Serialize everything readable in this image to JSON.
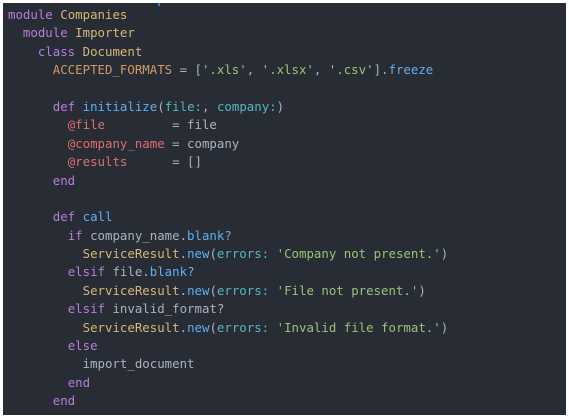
{
  "editor": {
    "language": "ruby",
    "theme_colors": {
      "background": "#282c34",
      "keyword": "#b57edc",
      "class": "#d8b776",
      "constant": "#d19a66",
      "string": "#98c379",
      "instance_variable": "#e06c75",
      "method": "#61afef",
      "symbol": "#56b6c2",
      "plain": "#abb2bf"
    },
    "lines": [
      [
        [
          "module",
          "kw"
        ],
        [
          " ",
          "plain"
        ],
        [
          "Companies",
          "cls"
        ]
      ],
      [
        [
          "  ",
          "plain"
        ],
        [
          "module",
          "kw"
        ],
        [
          " ",
          "plain"
        ],
        [
          "Importer",
          "cls"
        ]
      ],
      [
        [
          "    ",
          "plain"
        ],
        [
          "class",
          "kw"
        ],
        [
          " ",
          "plain"
        ],
        [
          "Document",
          "cls"
        ]
      ],
      [
        [
          "      ",
          "plain"
        ],
        [
          "ACCEPTED_FORMATS",
          "const"
        ],
        [
          " = [",
          "plain"
        ],
        [
          "'.xls'",
          "str"
        ],
        [
          ", ",
          "plain"
        ],
        [
          "'.xlsx'",
          "str"
        ],
        [
          ", ",
          "plain"
        ],
        [
          "'.csv'",
          "str"
        ],
        [
          "].",
          "plain"
        ],
        [
          "freeze",
          "fn"
        ]
      ],
      [],
      [
        [
          "      ",
          "plain"
        ],
        [
          "def",
          "kw"
        ],
        [
          " ",
          "plain"
        ],
        [
          "initialize",
          "fn"
        ],
        [
          "(",
          "plain"
        ],
        [
          "file:",
          "sym"
        ],
        [
          ", ",
          "plain"
        ],
        [
          "company:",
          "sym"
        ],
        [
          ")",
          "plain"
        ]
      ],
      [
        [
          "        ",
          "plain"
        ],
        [
          "@file",
          "ivar"
        ],
        [
          "         = file",
          "plain"
        ]
      ],
      [
        [
          "        ",
          "plain"
        ],
        [
          "@company_name",
          "ivar"
        ],
        [
          " = company",
          "plain"
        ]
      ],
      [
        [
          "        ",
          "plain"
        ],
        [
          "@results",
          "ivar"
        ],
        [
          "      = []",
          "plain"
        ]
      ],
      [
        [
          "      ",
          "plain"
        ],
        [
          "end",
          "kw"
        ]
      ],
      [],
      [
        [
          "      ",
          "plain"
        ],
        [
          "def",
          "kw"
        ],
        [
          " ",
          "plain"
        ],
        [
          "call",
          "fn"
        ]
      ],
      [
        [
          "        ",
          "plain"
        ],
        [
          "if",
          "kw"
        ],
        [
          " company_name.",
          "plain"
        ],
        [
          "blank?",
          "fn"
        ]
      ],
      [
        [
          "          ",
          "plain"
        ],
        [
          "ServiceResult",
          "cls"
        ],
        [
          ".",
          "plain"
        ],
        [
          "new",
          "fn"
        ],
        [
          "(",
          "plain"
        ],
        [
          "errors:",
          "sym"
        ],
        [
          " ",
          "plain"
        ],
        [
          "'Company not present.'",
          "str"
        ],
        [
          ")",
          "plain"
        ]
      ],
      [
        [
          "        ",
          "plain"
        ],
        [
          "elsif",
          "kw"
        ],
        [
          " file.",
          "plain"
        ],
        [
          "blank?",
          "fn"
        ]
      ],
      [
        [
          "          ",
          "plain"
        ],
        [
          "ServiceResult",
          "cls"
        ],
        [
          ".",
          "plain"
        ],
        [
          "new",
          "fn"
        ],
        [
          "(",
          "plain"
        ],
        [
          "errors:",
          "sym"
        ],
        [
          " ",
          "plain"
        ],
        [
          "'File not present.'",
          "str"
        ],
        [
          ")",
          "plain"
        ]
      ],
      [
        [
          "        ",
          "plain"
        ],
        [
          "elsif",
          "kw"
        ],
        [
          " invalid_format?",
          "plain"
        ]
      ],
      [
        [
          "          ",
          "plain"
        ],
        [
          "ServiceResult",
          "cls"
        ],
        [
          ".",
          "plain"
        ],
        [
          "new",
          "fn"
        ],
        [
          "(",
          "plain"
        ],
        [
          "errors:",
          "sym"
        ],
        [
          " ",
          "plain"
        ],
        [
          "'Invalid file format.'",
          "str"
        ],
        [
          ")",
          "plain"
        ]
      ],
      [
        [
          "        ",
          "plain"
        ],
        [
          "else",
          "kw"
        ]
      ],
      [
        [
          "          import_document",
          "plain"
        ]
      ],
      [
        [
          "        ",
          "plain"
        ],
        [
          "end",
          "kw"
        ]
      ],
      [
        [
          "      ",
          "plain"
        ],
        [
          "end",
          "kw"
        ]
      ]
    ]
  }
}
